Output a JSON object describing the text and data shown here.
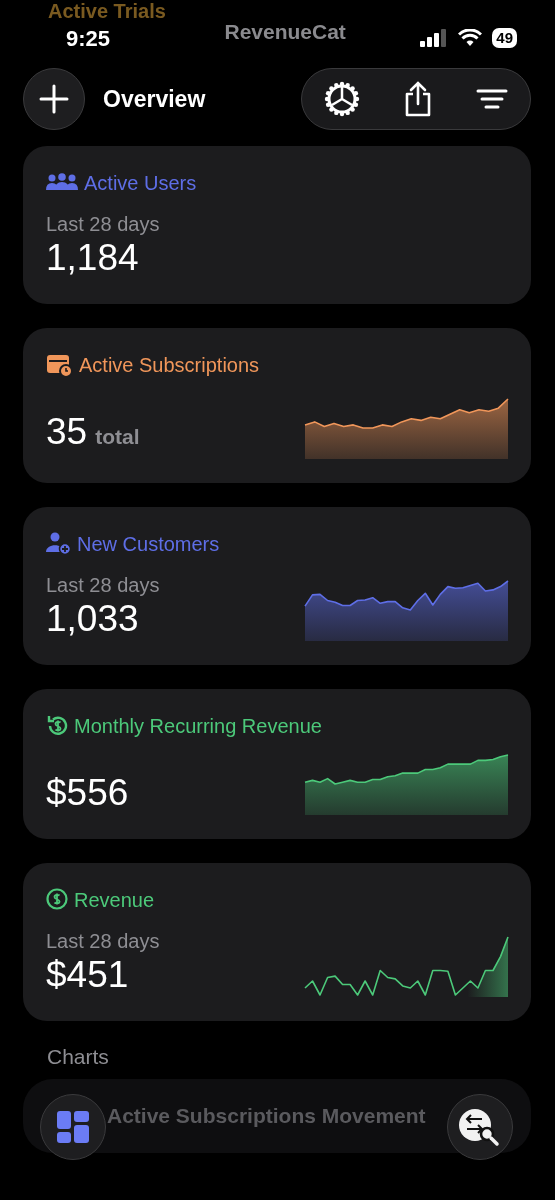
{
  "background_card": {
    "title": "Active Trials"
  },
  "status_bar": {
    "time": "9:25",
    "logo": "RevenueCat",
    "battery": "49"
  },
  "header": {
    "title": "Overview"
  },
  "cards": [
    {
      "kind": "users",
      "title": "Active Users",
      "color": "#5e6ee6",
      "caption": "Last 28 days",
      "value": "1,184"
    },
    {
      "kind": "calendar",
      "title": "Active Subscriptions",
      "color": "#f0965a",
      "value": "35",
      "unit": "total",
      "sparkline": true,
      "sparkline_filled": true
    },
    {
      "kind": "user-plus",
      "title": "New Customers",
      "color": "#5e6ee6",
      "caption": "Last 28 days",
      "value": "1,033",
      "sparkline": true,
      "sparkline_filled": true
    },
    {
      "kind": "dollar-cycle",
      "title": "Monthly Recurring Revenue",
      "color": "#4cc97a",
      "value": "$556",
      "sparkline": true,
      "sparkline_filled": true
    },
    {
      "kind": "dollar",
      "title": "Revenue",
      "color": "#4cc97a",
      "caption": "Last 28 days",
      "value": "$451",
      "sparkline": true,
      "sparkline_filled": false
    }
  ],
  "section_title": "Charts",
  "chart_rows": [
    {
      "title": "Active Subscriptions Movement"
    }
  ]
}
